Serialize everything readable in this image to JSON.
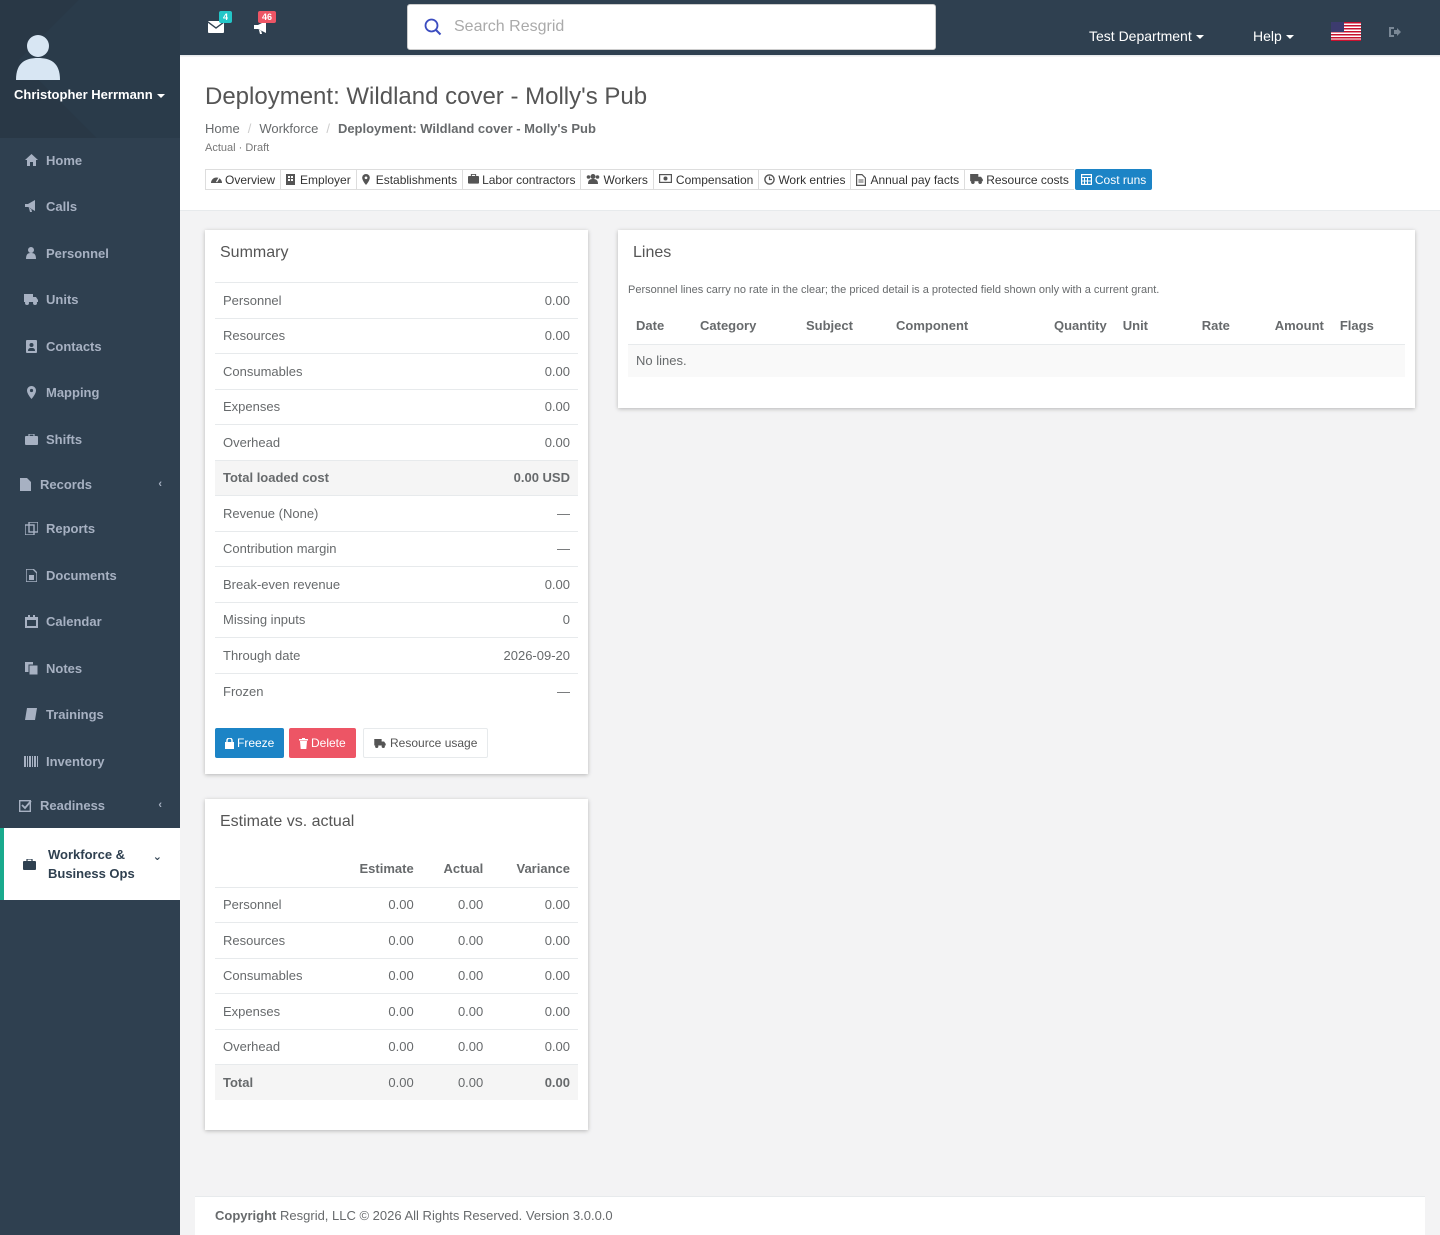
{
  "user": {
    "name": "Christopher Herrmann"
  },
  "sidebar": {
    "items": [
      {
        "label": "Home",
        "icon": "home-icon"
      },
      {
        "label": "Calls",
        "icon": "bullhorn-icon"
      },
      {
        "label": "Personnel",
        "icon": "user-icon"
      },
      {
        "label": "Units",
        "icon": "truck-icon"
      },
      {
        "label": "Contacts",
        "icon": "address-book-icon"
      },
      {
        "label": "Mapping",
        "icon": "map-marker-icon"
      },
      {
        "label": "Shifts",
        "icon": "briefcase-icon"
      },
      {
        "label": "Records",
        "icon": "file-icon"
      },
      {
        "label": "Reports",
        "icon": "copy-icon"
      },
      {
        "label": "Documents",
        "icon": "document-icon"
      },
      {
        "label": "Calendar",
        "icon": "calendar-icon"
      },
      {
        "label": "Notes",
        "icon": "notes-icon"
      },
      {
        "label": "Trainings",
        "icon": "book-icon"
      },
      {
        "label": "Inventory",
        "icon": "barcode-icon"
      },
      {
        "label": "Readiness",
        "icon": "check-square-icon"
      },
      {
        "label": "Workforce & Business Ops",
        "icon": "briefcase-icon"
      }
    ]
  },
  "topbar": {
    "messages_count": "4",
    "alerts_count": "46",
    "search_placeholder": "Search Resgrid",
    "department": "Test Department",
    "help": "Help"
  },
  "header": {
    "title": "Deployment: Wildland cover - Molly's Pub",
    "breadcrumb": [
      "Home",
      "Workforce",
      "Deployment: Wildland cover - Molly's Pub"
    ],
    "subline": "Actual · Draft",
    "tabs": [
      {
        "label": "Overview",
        "icon": "dashboard-icon"
      },
      {
        "label": "Employer",
        "icon": "building-icon"
      },
      {
        "label": "Establishments",
        "icon": "map-marker-icon"
      },
      {
        "label": "Labor contractors",
        "icon": "briefcase-icon"
      },
      {
        "label": "Workers",
        "icon": "users-icon"
      },
      {
        "label": "Compensation",
        "icon": "money-icon"
      },
      {
        "label": "Work entries",
        "icon": "clock-icon"
      },
      {
        "label": "Annual pay facts",
        "icon": "file-text-icon"
      },
      {
        "label": "Resource costs",
        "icon": "truck-icon"
      },
      {
        "label": "Cost runs",
        "icon": "calculator-icon"
      }
    ]
  },
  "summary": {
    "title": "Summary",
    "rows": [
      {
        "label": "Personnel",
        "value": "0.00"
      },
      {
        "label": "Resources",
        "value": "0.00"
      },
      {
        "label": "Consumables",
        "value": "0.00"
      },
      {
        "label": "Expenses",
        "value": "0.00"
      },
      {
        "label": "Overhead",
        "value": "0.00"
      },
      {
        "label": "Total loaded cost",
        "value": "0.00 USD"
      },
      {
        "label": "Revenue (None)",
        "value": "—"
      },
      {
        "label": "Contribution margin",
        "value": "—"
      },
      {
        "label": "Break-even revenue",
        "value": "0.00"
      },
      {
        "label": "Missing inputs",
        "value": "0"
      },
      {
        "label": "Through date",
        "value": "2026-09-20"
      },
      {
        "label": "Frozen",
        "value": "—"
      }
    ],
    "buttons": {
      "freeze": "Freeze",
      "delete": "Delete",
      "resource_usage": "Resource usage"
    }
  },
  "estimate": {
    "title": "Estimate vs. actual",
    "headers": [
      "",
      "Estimate",
      "Actual",
      "Variance"
    ],
    "rows": [
      [
        "Personnel",
        "0.00",
        "0.00",
        "0.00"
      ],
      [
        "Resources",
        "0.00",
        "0.00",
        "0.00"
      ],
      [
        "Consumables",
        "0.00",
        "0.00",
        "0.00"
      ],
      [
        "Expenses",
        "0.00",
        "0.00",
        "0.00"
      ],
      [
        "Overhead",
        "0.00",
        "0.00",
        "0.00"
      ],
      [
        "Total",
        "0.00",
        "0.00",
        "0.00"
      ]
    ]
  },
  "lines": {
    "title": "Lines",
    "note": "Personnel lines carry no rate in the clear; the priced detail is a protected field shown only with a current grant.",
    "headers": [
      "Date",
      "Category",
      "Subject",
      "Component",
      "Quantity",
      "Unit",
      "Rate",
      "Amount",
      "Flags"
    ],
    "empty": "No lines."
  },
  "footer": {
    "copyright_bold": "Copyright",
    "copyright_text": "Resgrid, LLC © 2026 All Rights Reserved.",
    "version": "Version 3.0.0.0"
  },
  "colors": {
    "sidebar": "#2f4050",
    "primary": "#1c84c6",
    "danger": "#ed5565",
    "teal_badge": "#23c6c8",
    "red_badge": "#ed5565",
    "active_accent": "#19aa8d"
  }
}
